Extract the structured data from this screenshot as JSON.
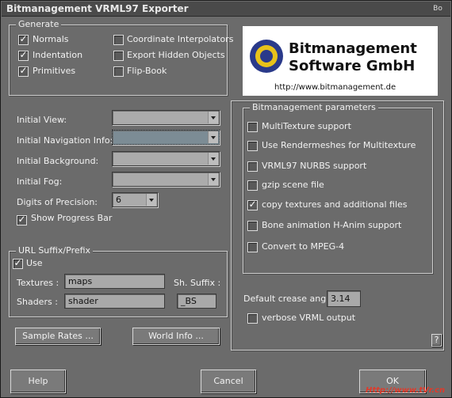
{
  "window": {
    "title": "Bitmanagement VRML97 Exporter",
    "corner_btn": "Bo"
  },
  "generate": {
    "label": "Generate",
    "left": [
      {
        "label": "Normals",
        "checked": true
      },
      {
        "label": "Indentation",
        "checked": true
      },
      {
        "label": "Primitives",
        "checked": true
      }
    ],
    "right": [
      {
        "label": "Coordinate Interpolators",
        "checked": false
      },
      {
        "label": "Export Hidden Objects",
        "checked": false
      },
      {
        "label": "Flip-Book",
        "checked": false
      }
    ]
  },
  "logo": {
    "line1": "Bitmanagement",
    "line2": "Software GmbH",
    "url": "http://www.bitmanagement.de",
    "accent": "#2a3a8a",
    "ring": "#e8c21a"
  },
  "options": {
    "initial_view": "Initial View:",
    "initial_nav": "Initial Navigation Info:",
    "initial_bg": "Initial Background:",
    "initial_fog": "Initial Fog:",
    "digits_label": "Digits of Precision:",
    "digits_value": "6",
    "progress_label": "Show Progress Bar",
    "progress_checked": true
  },
  "url": {
    "label": "URL Suffix/Prefix",
    "use_label": "Use",
    "use_checked": true,
    "textures_label": "Textures :",
    "textures_value": "maps",
    "shaders_label": "Shaders :",
    "shaders_value": "shader",
    "suffix_label": "Sh. Suffix :",
    "suffix_value": "_BS"
  },
  "params": {
    "label": "Bitmanagement parameters",
    "items": [
      {
        "label": "MultiTexture support",
        "checked": false
      },
      {
        "label": "Use Rendermeshes for Multitexture",
        "checked": false
      },
      {
        "label": "VRML97 NURBS support",
        "checked": false
      },
      {
        "label": "gzip scene file",
        "checked": false
      },
      {
        "label": "copy textures and additional files",
        "checked": true
      },
      {
        "label": "Bone animation H-Anim support",
        "checked": false
      },
      {
        "label": "Convert to MPEG-4",
        "checked": false
      }
    ]
  },
  "crease": {
    "label": "Default crease angle",
    "value": "3.14"
  },
  "verbose": {
    "label": "verbose VRML output",
    "checked": false
  },
  "buttons": {
    "sample_rates": "Sample Rates ...",
    "world_info": "World Info ...",
    "help": "Help",
    "cancel": "Cancel",
    "ok": "OK",
    "question": "?"
  },
  "watermark": "Http://www.tVr.cn"
}
